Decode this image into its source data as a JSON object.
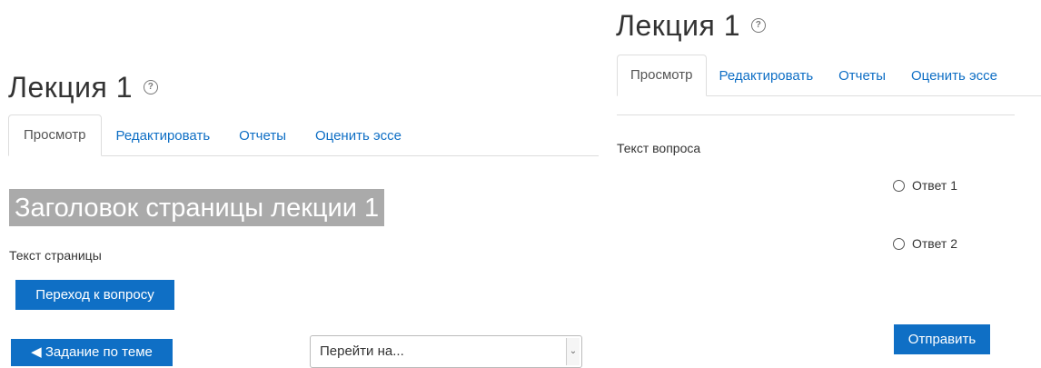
{
  "left": {
    "title": "Лекция 1",
    "tabs": [
      "Просмотр",
      "Редактировать",
      "Отчеты",
      "Оценить эссе"
    ],
    "page_heading": "Заголовок страницы лекции 1",
    "page_text": "Текст страницы",
    "goto_question_button": "Переход к вопросу",
    "prev_task_button": "◀ Задание по теме",
    "jump_select": "Перейти на..."
  },
  "right": {
    "title": "Лекция 1",
    "tabs": [
      "Просмотр",
      "Редактировать",
      "Отчеты",
      "Оценить эссе"
    ],
    "question_text": "Текст вопроса",
    "answers": [
      "Ответ 1",
      "Ответ 2"
    ],
    "submit_button": "Отправить"
  },
  "colors": {
    "accent": "#0f6fc5",
    "heading_bg": "#aaaaaa"
  },
  "icons": {
    "help": "help-circle-icon",
    "select_arrow": "chevron-down-icon"
  }
}
